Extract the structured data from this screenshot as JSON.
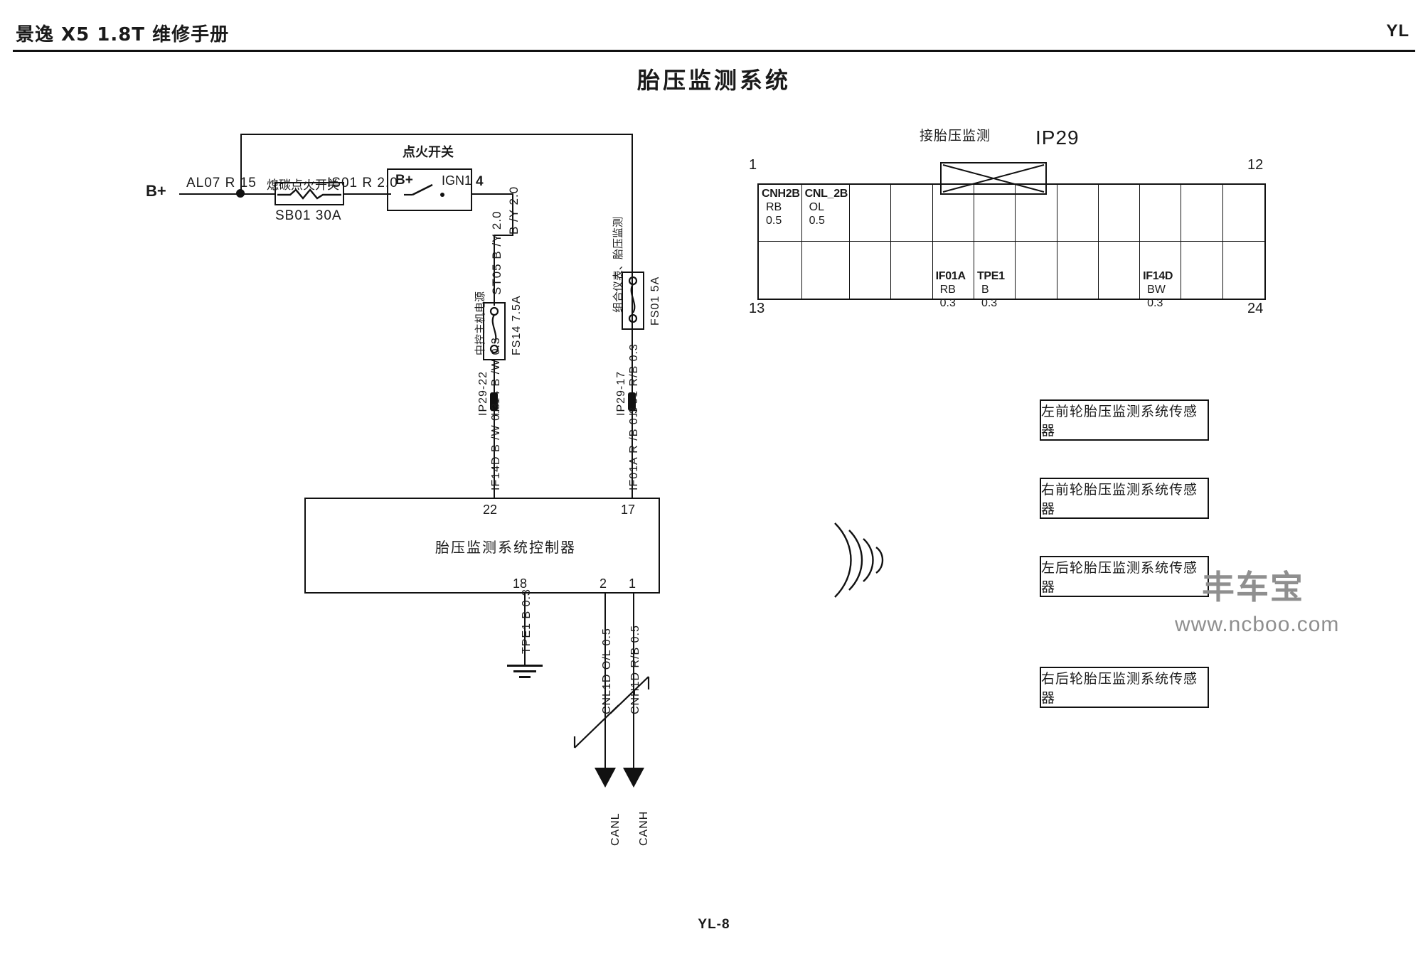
{
  "header": {
    "manual_title": "景逸 X5 1.8T 维修手册",
    "section_code": "YL"
  },
  "page_title": "胎压监测系统",
  "footer": "YL-8",
  "circuit": {
    "battery_label": "B+",
    "battery_wire": "AL07 R 15",
    "main_fuse_top_label": "熄碳点火开关",
    "main_fuse_name": "SB01 30A",
    "main_fuse_out_wire": "IS01 R 2.0",
    "ignition_switch": {
      "title": "点火开关",
      "in_pin": "B+",
      "out_pin": "IGN1",
      "out_pin_number": "4",
      "out_wire": "B /Y 2.0"
    },
    "branch_left": {
      "wire_top": "ST05 B /Y 2.0",
      "fuse_desc": "中控主机电源",
      "fuse_name": "FS14 7.5A",
      "wire_upper": "IF14 B /W 0.3",
      "connector_ref": "IP29-22",
      "wire_lower": "IF14D B /W 0.3",
      "pin": "22"
    },
    "branch_right": {
      "fuse_desc": "组合仪表、胎压监测",
      "fuse_name": "FS01 5A",
      "wire_upper": "IF01 R/B 0.3",
      "connector_ref": "IP29-17",
      "wire_lower": "IF01A R /B 0.3",
      "pin": "17"
    },
    "controller": {
      "name": "胎压监测系统控制器",
      "pins_top": [
        "22",
        "17"
      ],
      "pins_bottom": [
        "18",
        "2",
        "1"
      ]
    },
    "ground": {
      "wire": "TPE1 B 0.3"
    },
    "can_bus": {
      "low": {
        "wire": "CNL1D O/L 0.5",
        "label": "CANL"
      },
      "high": {
        "wire": "CNH1D R/B 0.5",
        "label": "CANH"
      }
    }
  },
  "connector": {
    "caption": "接胎压监测",
    "name": "IP29",
    "corner_labels": {
      "top_left": "1",
      "top_right": "12",
      "bottom_left": "13",
      "bottom_right": "24"
    },
    "row1": [
      {
        "circuit": "CNH2B",
        "color": "RB",
        "gauge": "0.5"
      },
      {
        "circuit": "CNL_2B",
        "color": "OL",
        "gauge": "0.5"
      },
      {
        "circuit": "",
        "color": "",
        "gauge": ""
      },
      {
        "circuit": "",
        "color": "",
        "gauge": ""
      },
      {
        "circuit": "",
        "color": "",
        "gauge": ""
      },
      {
        "circuit": "",
        "color": "",
        "gauge": ""
      },
      {
        "circuit": "",
        "color": "",
        "gauge": ""
      },
      {
        "circuit": "",
        "color": "",
        "gauge": ""
      },
      {
        "circuit": "",
        "color": "",
        "gauge": ""
      },
      {
        "circuit": "",
        "color": "",
        "gauge": ""
      },
      {
        "circuit": "",
        "color": "",
        "gauge": ""
      },
      {
        "circuit": "",
        "color": "",
        "gauge": ""
      }
    ],
    "row2": [
      {
        "circuit": "",
        "color": "",
        "gauge": ""
      },
      {
        "circuit": "",
        "color": "",
        "gauge": ""
      },
      {
        "circuit": "",
        "color": "",
        "gauge": ""
      },
      {
        "circuit": "",
        "color": "",
        "gauge": ""
      },
      {
        "circuit": "IF01A",
        "color": "RB",
        "gauge": "0.3"
      },
      {
        "circuit": "TPE1",
        "color": "B",
        "gauge": "0.3"
      },
      {
        "circuit": "",
        "color": "",
        "gauge": ""
      },
      {
        "circuit": "",
        "color": "",
        "gauge": ""
      },
      {
        "circuit": "",
        "color": "",
        "gauge": ""
      },
      {
        "circuit": "IF14D",
        "color": "BW",
        "gauge": "0.3"
      },
      {
        "circuit": "",
        "color": "",
        "gauge": ""
      },
      {
        "circuit": "",
        "color": "",
        "gauge": ""
      }
    ]
  },
  "sensors": [
    "左前轮胎压监测系统传感器",
    "右前轮胎压监测系统传感器",
    "左后轮胎压监测系统传感器",
    "右后轮胎压监测系统传感器"
  ],
  "watermark": {
    "main": "丰车宝",
    "sub": "www.ncboo.com"
  }
}
